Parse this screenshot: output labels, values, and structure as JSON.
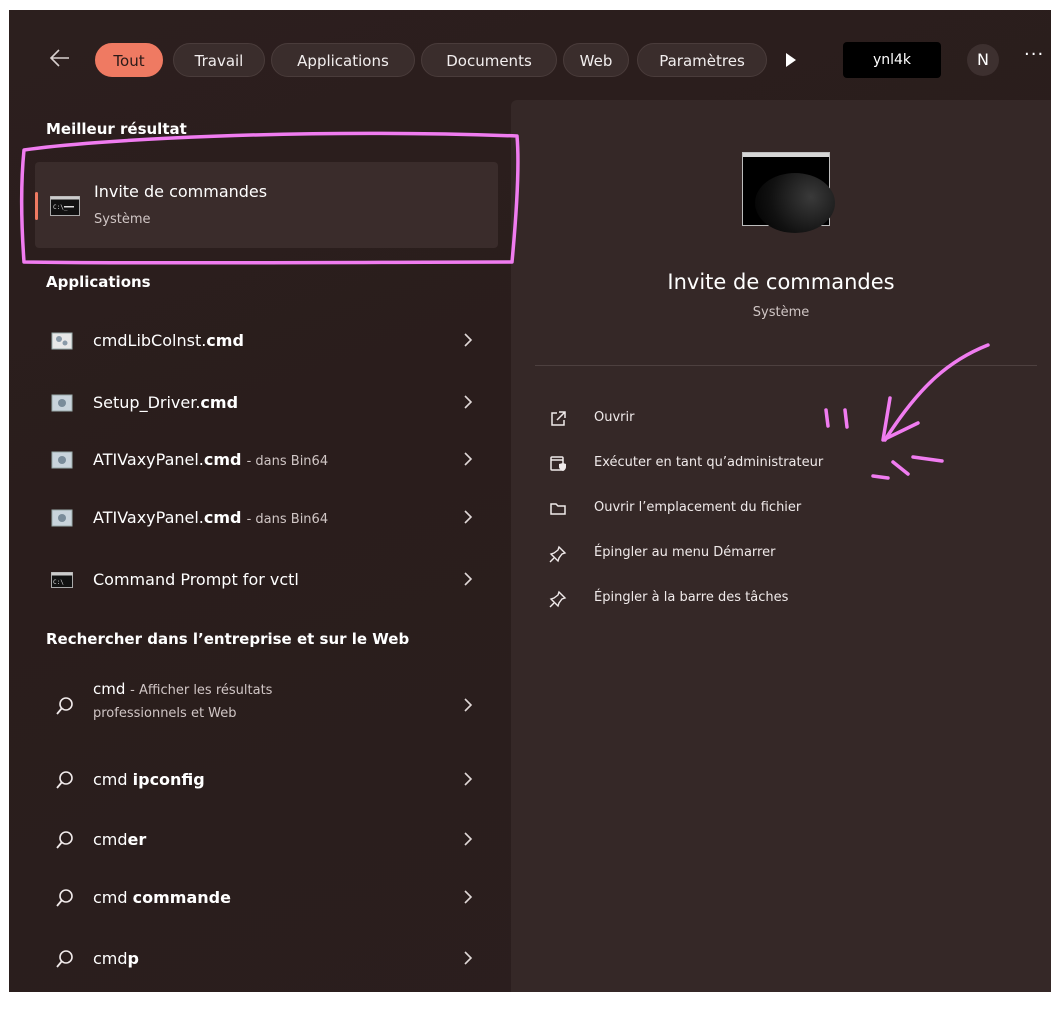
{
  "tabs": [
    "Tout",
    "Travail",
    "Applications",
    "Documents",
    "Web",
    "Paramètres"
  ],
  "account_label": "ynl4k",
  "avatar_initial": "N",
  "more_label": "···",
  "best_match": {
    "heading": "Meilleur résultat",
    "name": "Invite de commandes",
    "type": "Système"
  },
  "apps": {
    "heading": "Applications",
    "items": [
      {
        "name_plain": "cmdLibColnst.",
        "name_bold": "cmd",
        "location": ""
      },
      {
        "name_plain": "Setup_Driver.",
        "name_bold": "cmd",
        "location": ""
      },
      {
        "name_plain": "ATIVaxyPanel.",
        "name_bold": "cmd",
        "location": "- dans Bin64"
      },
      {
        "name_plain": "ATIVaxyPanel.",
        "name_bold": "cmd",
        "location": "- dans Bin64"
      },
      {
        "name_plain": "Command Prompt for vctl",
        "name_bold": "",
        "location": ""
      }
    ]
  },
  "web": {
    "heading": "Rechercher dans l’entreprise et sur le Web",
    "first": {
      "query": "cmd",
      "hint_line1": "- Afficher les résultats",
      "hint_line2": "professionnels et Web"
    },
    "items": [
      {
        "prefix": "cmd ",
        "bold": "ipconfig"
      },
      {
        "prefix": "cmd",
        "bold": "er"
      },
      {
        "prefix": "cmd ",
        "bold": "commande"
      },
      {
        "prefix": "cmd",
        "bold": "p"
      }
    ]
  },
  "detail": {
    "title": "Invite de commandes",
    "subtitle": "Système",
    "actions": [
      {
        "label": "Ouvrir",
        "icon": "open-external-icon"
      },
      {
        "label": "Exécuter en tant qu’administrateur",
        "icon": "admin-shield-icon"
      },
      {
        "label": "Ouvrir l’emplacement du fichier",
        "icon": "folder-icon"
      },
      {
        "label": "Épingler au menu Démarrer",
        "icon": "pin-icon"
      },
      {
        "label": "Épingler à la barre des tâches",
        "icon": "pin-icon"
      }
    ]
  },
  "colors": {
    "accent": "#ef7a62",
    "annotation": "#f07cf0",
    "background": "#2b1e1d",
    "panel": "#352827"
  }
}
